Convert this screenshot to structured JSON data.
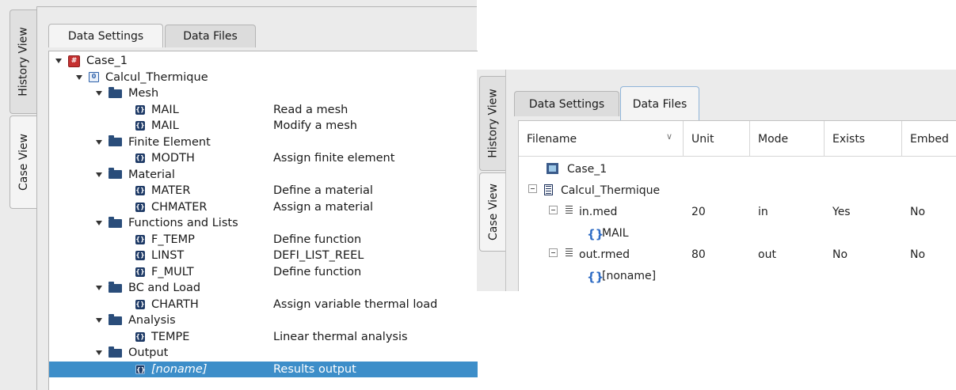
{
  "left_window": {
    "side_tabs": {
      "history": "History View",
      "case": "Case View"
    },
    "tabs": {
      "data_settings": "Data Settings",
      "data_files": "Data Files"
    },
    "tree": [
      {
        "level": 0,
        "kind": "case",
        "name": "Case_1",
        "desc": ""
      },
      {
        "level": 1,
        "kind": "stage",
        "name": "Calcul_Thermique",
        "desc": ""
      },
      {
        "level": 2,
        "kind": "category",
        "name": "Mesh",
        "desc": ""
      },
      {
        "level": 3,
        "kind": "command",
        "name": "MAIL",
        "desc": "Read a mesh"
      },
      {
        "level": 3,
        "kind": "command",
        "name": "MAIL",
        "desc": "Modify a mesh"
      },
      {
        "level": 2,
        "kind": "category",
        "name": "Finite Element",
        "desc": ""
      },
      {
        "level": 3,
        "kind": "command",
        "name": "MODTH",
        "desc": "Assign finite element"
      },
      {
        "level": 2,
        "kind": "category",
        "name": "Material",
        "desc": ""
      },
      {
        "level": 3,
        "kind": "command",
        "name": "MATER",
        "desc": "Define a material"
      },
      {
        "level": 3,
        "kind": "command",
        "name": "CHMATER",
        "desc": "Assign a material"
      },
      {
        "level": 2,
        "kind": "category",
        "name": "Functions and Lists",
        "desc": ""
      },
      {
        "level": 3,
        "kind": "command",
        "name": "F_TEMP",
        "desc": "Define function"
      },
      {
        "level": 3,
        "kind": "command",
        "name": "LINST",
        "desc": "DEFI_LIST_REEL"
      },
      {
        "level": 3,
        "kind": "command",
        "name": "F_MULT",
        "desc": "Define function"
      },
      {
        "level": 2,
        "kind": "category",
        "name": "BC and Load",
        "desc": ""
      },
      {
        "level": 3,
        "kind": "command",
        "name": "CHARTH",
        "desc": "Assign variable thermal load"
      },
      {
        "level": 2,
        "kind": "category",
        "name": "Analysis",
        "desc": ""
      },
      {
        "level": 3,
        "kind": "command",
        "name": "TEMPE",
        "desc": "Linear thermal analysis"
      },
      {
        "level": 2,
        "kind": "category",
        "name": "Output",
        "desc": ""
      },
      {
        "level": 3,
        "kind": "command",
        "name": "[noname]",
        "desc": "Results output",
        "selected": true
      }
    ]
  },
  "right_window": {
    "side_tabs": {
      "history": "History View",
      "case": "Case View"
    },
    "tabs": {
      "data_settings": "Data Settings",
      "data_files": "Data Files"
    },
    "columns": [
      "Filename",
      "Unit",
      "Mode",
      "Exists",
      "Embed"
    ],
    "rows": [
      {
        "kind": "case",
        "filename": "Case_1",
        "unit": "",
        "mode": "",
        "exists": "",
        "embed": ""
      },
      {
        "kind": "stage",
        "filename": "Calcul_Thermique",
        "unit": "",
        "mode": "",
        "exists": "",
        "embed": ""
      },
      {
        "kind": "file",
        "filename": "in.med",
        "unit": "20",
        "mode": "in",
        "exists": "Yes",
        "embed": "No"
      },
      {
        "kind": "command",
        "filename": "MAIL",
        "unit": "",
        "mode": "",
        "exists": "",
        "embed": ""
      },
      {
        "kind": "file",
        "filename": "out.rmed",
        "unit": "80",
        "mode": "out",
        "exists": "No",
        "embed": "No"
      },
      {
        "kind": "command",
        "filename": "[noname]",
        "unit": "",
        "mode": "",
        "exists": "",
        "embed": ""
      }
    ]
  }
}
